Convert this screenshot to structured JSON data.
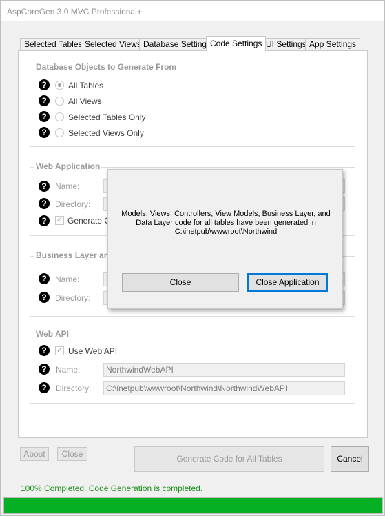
{
  "window": {
    "title": "AspCoreGen 3.0 MVC Professional+"
  },
  "tabs": [
    "Selected Tables",
    "Selected Views",
    "Database Settings",
    "Code Settings",
    "UI Settings",
    "App Settings"
  ],
  "active_tab": "Code Settings",
  "db_objects": {
    "legend": "Database Objects to Generate From",
    "options": [
      "All Tables",
      "All Views",
      "Selected Tables Only",
      "Selected Views Only"
    ],
    "selected": "All Tables"
  },
  "web_app": {
    "legend": "Web Application",
    "name_label": "Name:",
    "directory_label": "Directory:",
    "generate_label": "Generate Co"
  },
  "business_layer": {
    "legend": "Business Layer an",
    "name_label": "Name:",
    "directory_label": "Directory:"
  },
  "web_api": {
    "legend": "Web API",
    "use_label": "Use Web API",
    "name_label": "Name:",
    "name_value": "NorthwindWebAPI",
    "directory_label": "Directory:",
    "directory_value": "C:\\inetpub\\wwwroot\\Northwind\\NorthwindWebAPI"
  },
  "buttons": {
    "about": "About",
    "close": "Close",
    "generate": "Generate Code for All Tables",
    "cancel": "Cancel"
  },
  "status": "100% Completed.  Code Generation is completed.",
  "progress_fraction": 1.0,
  "dialog": {
    "message_line1": "Models, Views, Controllers, View Models, Business Layer, and",
    "message_line2": "Data Layer code for all tables have been generated in",
    "message_line3": "C:\\inetpub\\wwwroot\\Northwind",
    "close_label": "Close",
    "close_app_label": "Close Application"
  },
  "colors": {
    "status_green": "#1e8f1e",
    "progress_green": "#06b025",
    "focus_blue": "#0078d7"
  }
}
